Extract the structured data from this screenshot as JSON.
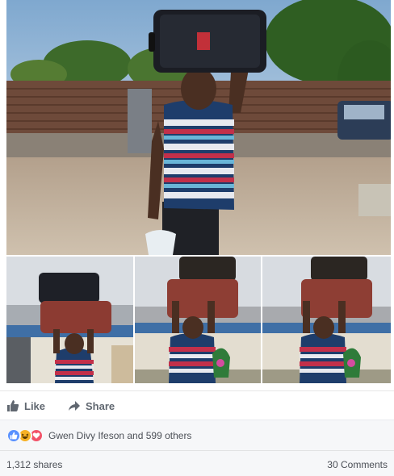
{
  "post": {
    "actions": {
      "like_label": "Like",
      "share_label": "Share"
    },
    "reactions": {
      "types": [
        "like",
        "haha",
        "love"
      ],
      "text": "Gwen Divy Ifeson and 599 others"
    },
    "stats": {
      "shares": "1,312 shares",
      "comments": "30 Comments"
    }
  },
  "colors": {
    "like_reaction": "#5890ff",
    "haha_reaction": "#f7b125",
    "love_reaction": "#f25268",
    "action_text": "#606770"
  }
}
